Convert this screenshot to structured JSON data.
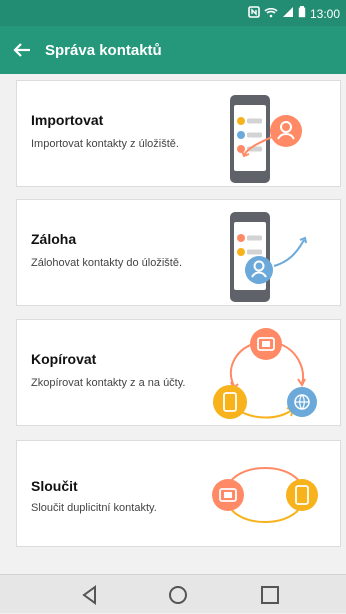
{
  "status": {
    "time": "13:00"
  },
  "appbar": {
    "title": "Správa kontaktů"
  },
  "items": [
    {
      "title": "Importovat",
      "desc": "Importovat kontakty z úložiště."
    },
    {
      "title": "Záloha",
      "desc": "Zálohovat kontakty do úložiště."
    },
    {
      "title": "Kopírovat",
      "desc": "Zkopírovat kontakty z a na účty."
    },
    {
      "title": "Sloučit",
      "desc": "Sloučit duplicitní kontakty."
    }
  ],
  "colors": {
    "statusbar": "#228d73",
    "appbar": "#25977b",
    "accent_orange": "#ff8a65",
    "accent_yellow": "#f7b21c",
    "accent_blue": "#6aa9d9"
  },
  "icons": {
    "back": "arrow-left-icon",
    "nav_back": "triangle-back-icon",
    "nav_home": "circle-home-icon",
    "nav_recent": "square-recent-icon"
  }
}
